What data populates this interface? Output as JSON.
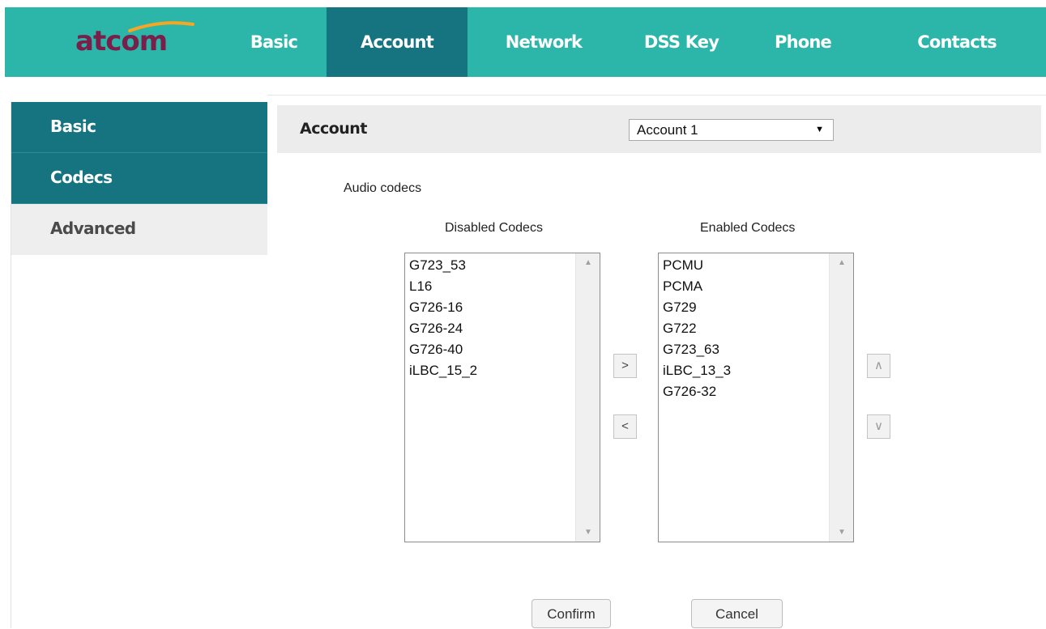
{
  "brand": {
    "logo_text": "atcom",
    "logo_color": "#7a1f4a",
    "swoosh_color": "#f5a623"
  },
  "colors": {
    "topbar": "#2cb5a9",
    "active": "#157480",
    "panel_bg": "#ececec"
  },
  "top_nav": {
    "items": [
      {
        "label": "Basic",
        "active": false
      },
      {
        "label": "Account",
        "active": true
      },
      {
        "label": "Network",
        "active": false
      },
      {
        "label": "DSS Key",
        "active": false
      },
      {
        "label": "Phone",
        "active": false
      },
      {
        "label": "Contacts",
        "active": false
      }
    ]
  },
  "sidebar": {
    "items": [
      {
        "label": "Basic",
        "active": true
      },
      {
        "label": "Codecs",
        "active": true
      },
      {
        "label": "Advanced",
        "active": false
      }
    ]
  },
  "account_bar": {
    "label": "Account",
    "selected": "Account 1",
    "arrow": "▼"
  },
  "codecs": {
    "section_label": "Audio codecs",
    "disabled_title": "Disabled Codecs",
    "enabled_title": "Enabled Codecs",
    "disabled": [
      "G723_53",
      "L16",
      "G726-16",
      "G726-24",
      "G726-40",
      "iLBC_15_2"
    ],
    "enabled": [
      "PCMU",
      "PCMA",
      "G729",
      "G722",
      "G723_63",
      "iLBC_13_3",
      "G726-32"
    ],
    "move_right": ">",
    "move_left": "<",
    "move_up": "∧",
    "move_down": "∨",
    "scroll_up": "▲",
    "scroll_down": "▼"
  },
  "actions": {
    "confirm": "Confirm",
    "cancel": "Cancel"
  }
}
